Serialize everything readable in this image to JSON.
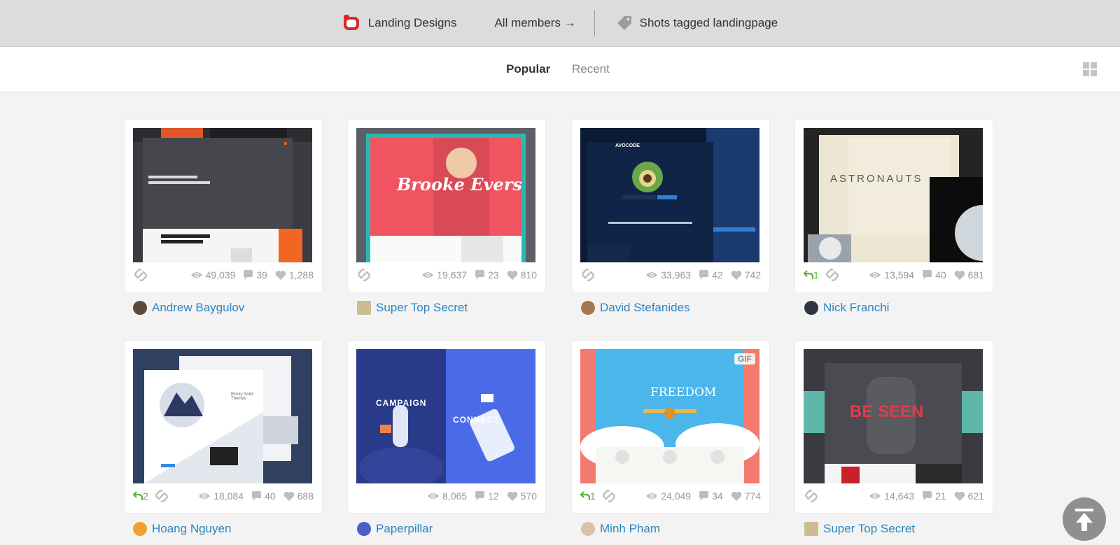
{
  "header": {
    "team_name": "Landing Designs",
    "members_link": "All members →",
    "tag_link": "Shots tagged landingpage"
  },
  "tabs": {
    "popular": "Popular",
    "recent": "Recent"
  },
  "colors": {
    "accent_link": "#2a86c2",
    "rebound": "#5fb13c",
    "stat_gray": "#999999",
    "team_logo": "#d6282b"
  },
  "shots": [
    {
      "author": "Andrew Baygulov",
      "views": "49,039",
      "comments": "39",
      "likes": "1,288",
      "rebounds": ""
    },
    {
      "author": "Super Top Secret",
      "views": "19,637",
      "comments": "23",
      "likes": "810",
      "rebounds": "",
      "thumb_text": "Brooke Evers"
    },
    {
      "author": "David Stefanides",
      "views": "33,963",
      "comments": "42",
      "likes": "742",
      "rebounds": "",
      "thumb_text": "AVOCODE"
    },
    {
      "author": "Nick Franchi",
      "views": "13,594",
      "comments": "40",
      "likes": "681",
      "rebounds": "1",
      "thumb_text": "ASTRONAUTS"
    },
    {
      "author": "Hoang Nguyen",
      "views": "18,084",
      "comments": "40",
      "likes": "688",
      "rebounds": "2",
      "thumb_text": "Rocky Solid Themes"
    },
    {
      "author": "Paperpillar",
      "views": "8,065",
      "comments": "12",
      "likes": "570",
      "rebounds": "",
      "thumb_text": "CAMPAIGN",
      "thumb_text_2": "CONNECT"
    },
    {
      "author": "Minh Pham",
      "views": "24,049",
      "comments": "34",
      "likes": "774",
      "rebounds": "1",
      "thumb_text": "FREEDOM",
      "badge": "GIF"
    },
    {
      "author": "Super Top Secret",
      "views": "14,643",
      "comments": "21",
      "likes": "621",
      "rebounds": "",
      "thumb_text": "BE SEEN"
    }
  ]
}
